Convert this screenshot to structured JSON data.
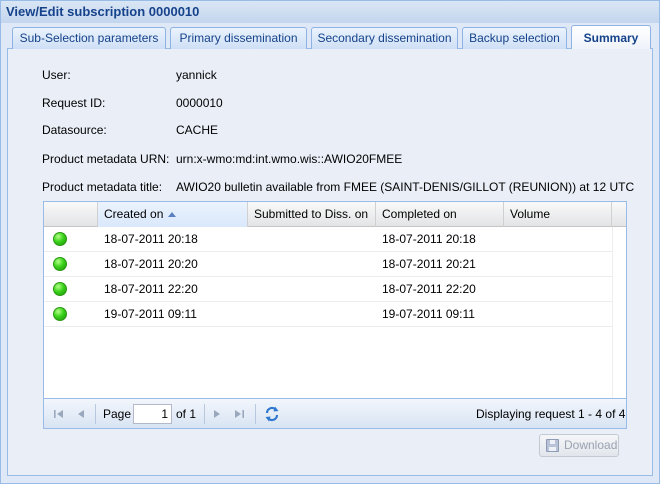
{
  "window": {
    "title": "View/Edit subscription 0000010"
  },
  "tabs": [
    {
      "label": "Sub-Selection parameters",
      "active": false
    },
    {
      "label": "Primary dissemination",
      "active": false
    },
    {
      "label": "Secondary dissemination",
      "active": false
    },
    {
      "label": "Backup selection",
      "active": false
    },
    {
      "label": "Summary",
      "active": true
    }
  ],
  "summary": {
    "fields": [
      {
        "label": "User:",
        "value": "yannick"
      },
      {
        "label": "Request ID:",
        "value": "0000010"
      },
      {
        "label": "Datasource:",
        "value": "CACHE"
      },
      {
        "label": "Product metadata URN:",
        "value": "urn:x-wmo:md:int.wmo.wis::AWIO20FMEE"
      },
      {
        "label": "Product metadata title:",
        "value": "AWIO20 bulletin available from FMEE (SAINT-DENIS/GILLOT (REUNION)) at 12 UTC"
      }
    ]
  },
  "grid": {
    "columns": [
      "",
      "Created on",
      "Submitted to Diss. on",
      "Completed on",
      "Volume"
    ],
    "sorted_column": "Created on",
    "sort_direction": "ascending",
    "status_color": "#3ad31b",
    "rows": [
      {
        "status": "green",
        "created": "18-07-2011 20:18",
        "submitted": "",
        "completed": "18-07-2011 20:18",
        "volume": ""
      },
      {
        "status": "green",
        "created": "18-07-2011 20:20",
        "submitted": "",
        "completed": "18-07-2011 20:21",
        "volume": ""
      },
      {
        "status": "green",
        "created": "18-07-2011 22:20",
        "submitted": "",
        "completed": "18-07-2011 22:20",
        "volume": ""
      },
      {
        "status": "green",
        "created": "19-07-2011 09:11",
        "submitted": "",
        "completed": "19-07-2011 09:11",
        "volume": ""
      }
    ]
  },
  "pager": {
    "page_label": "Page",
    "page_value": "1",
    "of_label": "of 1",
    "display_text": "Displaying request 1 - 4 of 4",
    "icons": [
      "first-page-icon",
      "prev-page-icon",
      "next-page-icon",
      "last-page-icon",
      "refresh-icon"
    ]
  },
  "footer": {
    "download_label": "Download",
    "download_enabled": false
  },
  "colors": {
    "accent": "#15428b",
    "border": "#99bbe8",
    "background": "#dfe8f6"
  }
}
